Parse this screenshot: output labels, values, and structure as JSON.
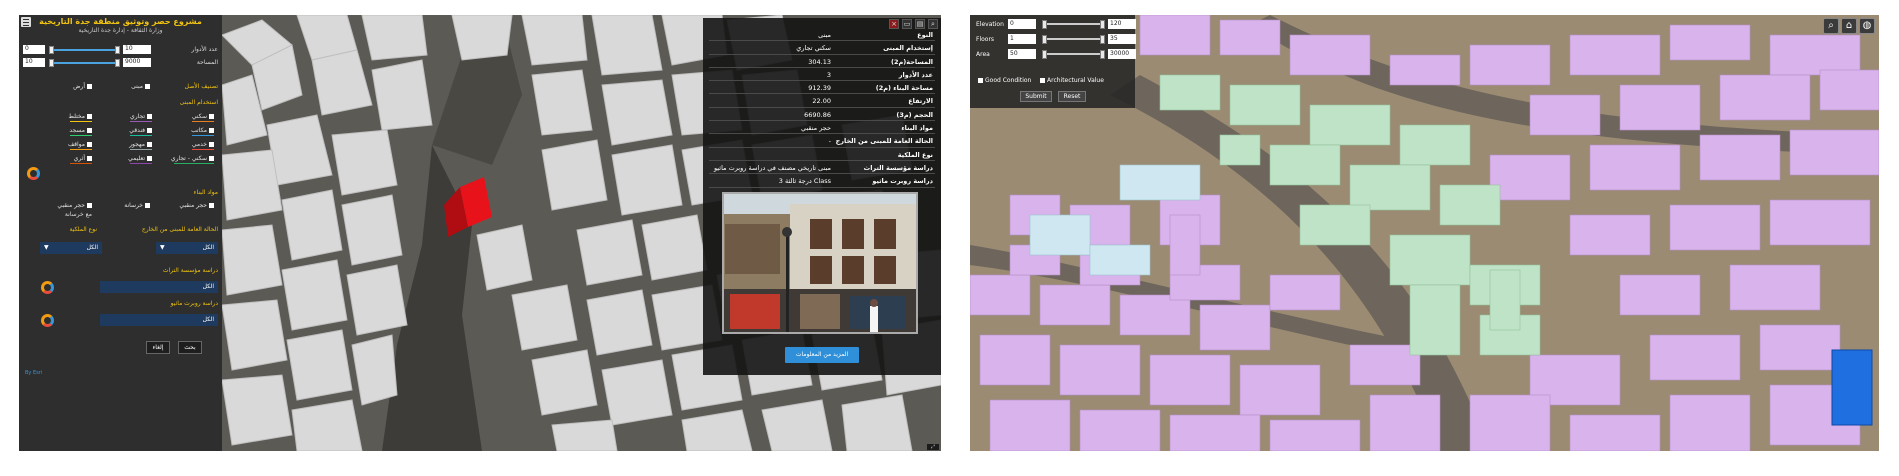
{
  "left_app": {
    "title": "مشروع حصر وتوثيق منطقة جدة التاريخية",
    "subtitle": "وزارة الثقافة - إدارة جدة التاريخية",
    "filters": {
      "floors": {
        "label": "عدد الأدوار",
        "min": "0",
        "max": "10"
      },
      "area": {
        "label": "المساحة",
        "min": "10",
        "max": "9000"
      }
    },
    "classification": {
      "heading": "تصنيف الأصل",
      "options": [
        "مبنى",
        "أرض"
      ]
    },
    "usage": {
      "heading": "استخدام المبنى",
      "options": [
        "سكني",
        "تجاري",
        "مختلط",
        "مكاتب",
        "فندقي",
        "مسجد",
        "خدمي",
        "مهجور",
        "مواقف",
        "إداري",
        "تعليمي",
        "أثري",
        "سكني - تجاري"
      ]
    },
    "material": {
      "heading": "مواد البناء",
      "options": [
        "حجر منقبي",
        "خرسانة",
        "مع خرسانة",
        "حجر منقبي"
      ]
    },
    "condition": {
      "label": "الحالة العامة للمبنى من الخارج",
      "value": "الكل"
    },
    "ownership": {
      "label": "نوع الملكية",
      "value": "الكل"
    },
    "heritage_study": {
      "label": "دراسة مؤسسة التراث",
      "value": "الكل"
    },
    "robert_study": {
      "label": "دراسة روبرت ماثيو",
      "value": "الكل"
    },
    "search_label": "بحث",
    "cancel_label": "إلغاء",
    "footer": "By Esri"
  },
  "popup": {
    "tools": [
      "zoom-icon",
      "print-icon",
      "collapse-icon",
      "close-icon"
    ],
    "rows": [
      {
        "key": "النوع",
        "value": "مبنى"
      },
      {
        "key": "إستخدام المبنى",
        "value": "سكني تجاري"
      },
      {
        "key": "المساحة(م2)",
        "value": "304.13"
      },
      {
        "key": "عدد الأدوار",
        "value": "3"
      },
      {
        "key": "مساحة البناء (م2)",
        "value": "912.39"
      },
      {
        "key": "الارتفاع",
        "value": "22.00"
      },
      {
        "key": "الحجم (م3)",
        "value": "6690.86"
      },
      {
        "key": "مواد البناء",
        "value": "حجر منقبي"
      },
      {
        "key": "الحالة العامة للمبنى من الخارج",
        "value": "-"
      },
      {
        "key": "نوع الملكية",
        "value": ""
      },
      {
        "key": "دراسة مؤسسة التراث",
        "value": "مبنى تاريخي مصنف في دراسة روبرت ماثيو"
      },
      {
        "key": "دراسة روبرت ماثيو",
        "value": "Class درجة ثالثة 3"
      }
    ],
    "more_label": "المزيد من المعلومات",
    "highlight_color": "#e8131a"
  },
  "right_app": {
    "filters": [
      {
        "label": "Elevation",
        "min": "0",
        "max": "120"
      },
      {
        "label": "Floors",
        "min": "1",
        "max": "35"
      },
      {
        "label": "Area",
        "min": "50",
        "max": "30000"
      }
    ],
    "checks": [
      "Good Condition",
      "Architectural Value"
    ],
    "submit_label": "Submit",
    "reset_label": "Reset",
    "tools": [
      "search-icon",
      "home-icon",
      "globe-icon"
    ],
    "colors": {
      "residential": "#d9b3ec",
      "commercial": "#bfe3c6",
      "selected": "#1f6fe0"
    }
  }
}
